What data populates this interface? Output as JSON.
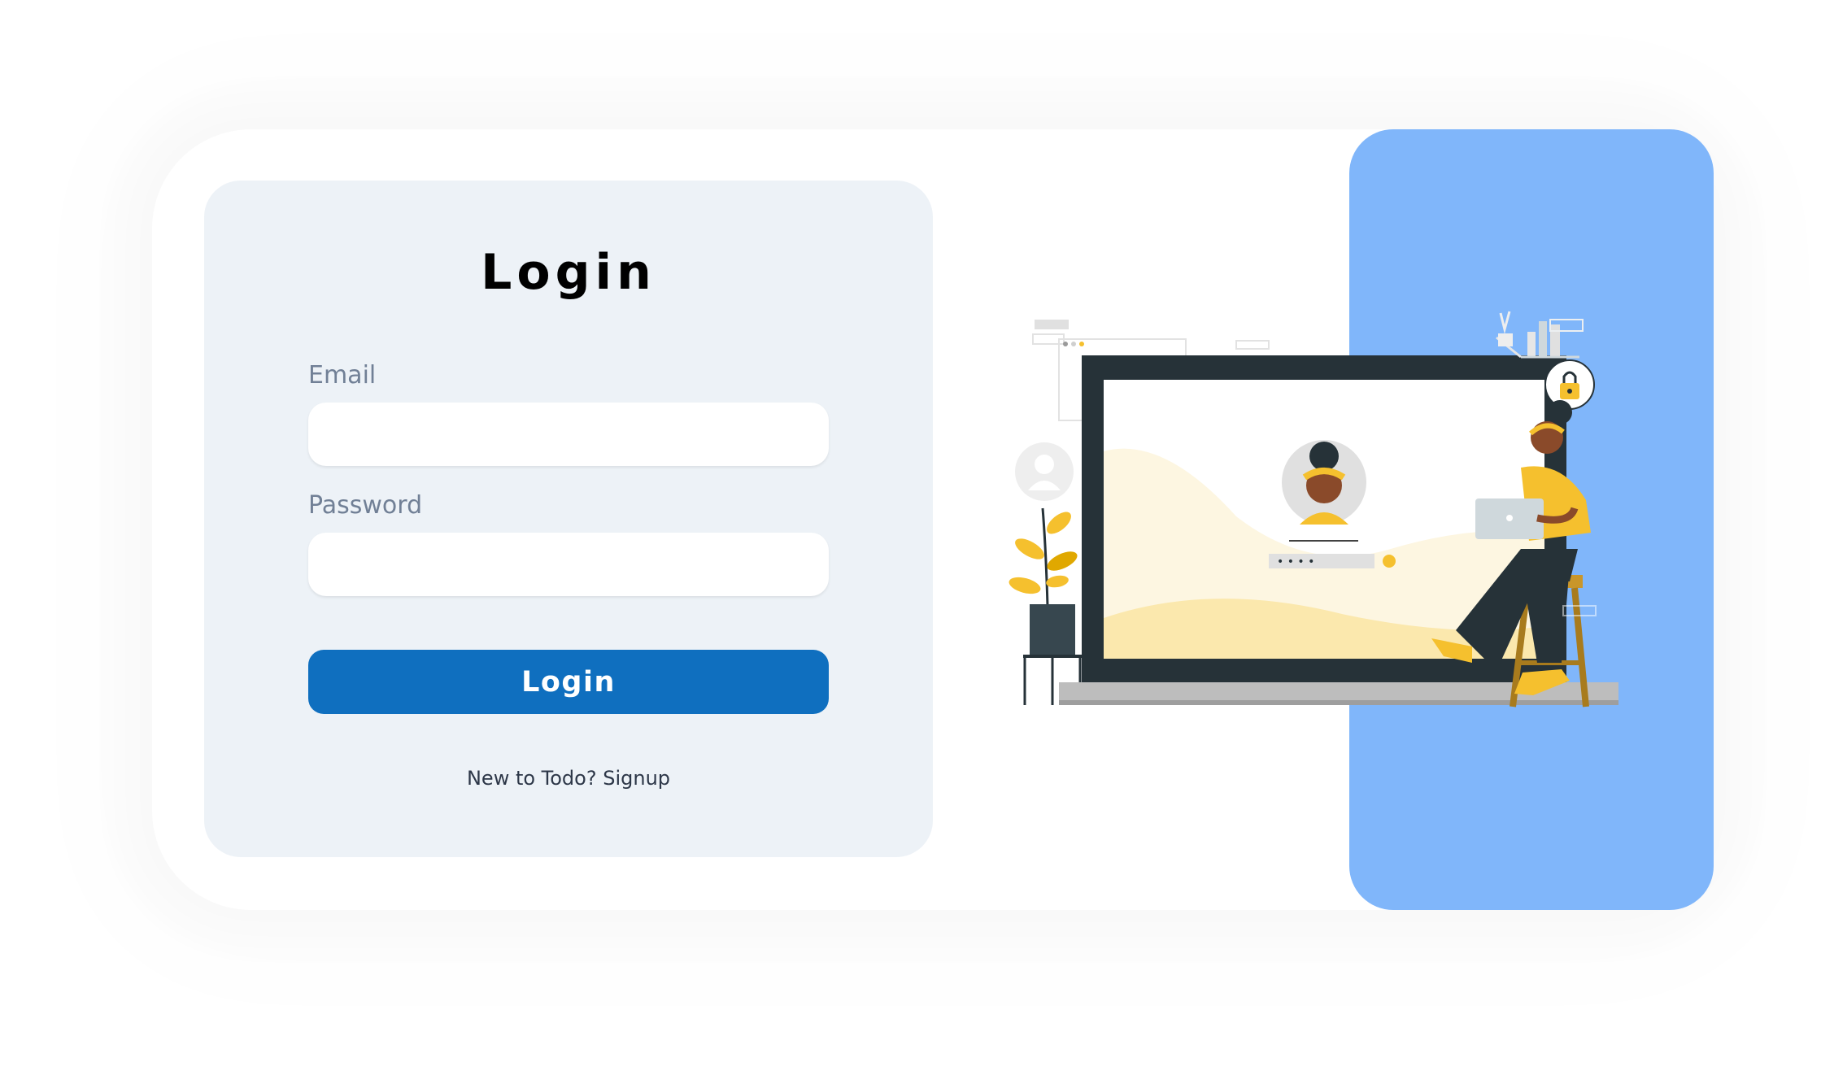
{
  "login_form": {
    "title": "Login",
    "email_label": "Email",
    "email_value": "",
    "password_label": "Password",
    "password_value": "",
    "submit_label": "Login",
    "signup_prompt": "New to Todo?",
    "signup_link": "Signup"
  },
  "illustration": {
    "masked_password": "• • • •",
    "icon": "padlock-icon"
  },
  "colors": {
    "form_panel": "#edf2f7",
    "accent_panel": "#80b6fa",
    "button": "#0f6fbf",
    "label": "#718096",
    "illustration_yellow": "#f5c02e"
  }
}
